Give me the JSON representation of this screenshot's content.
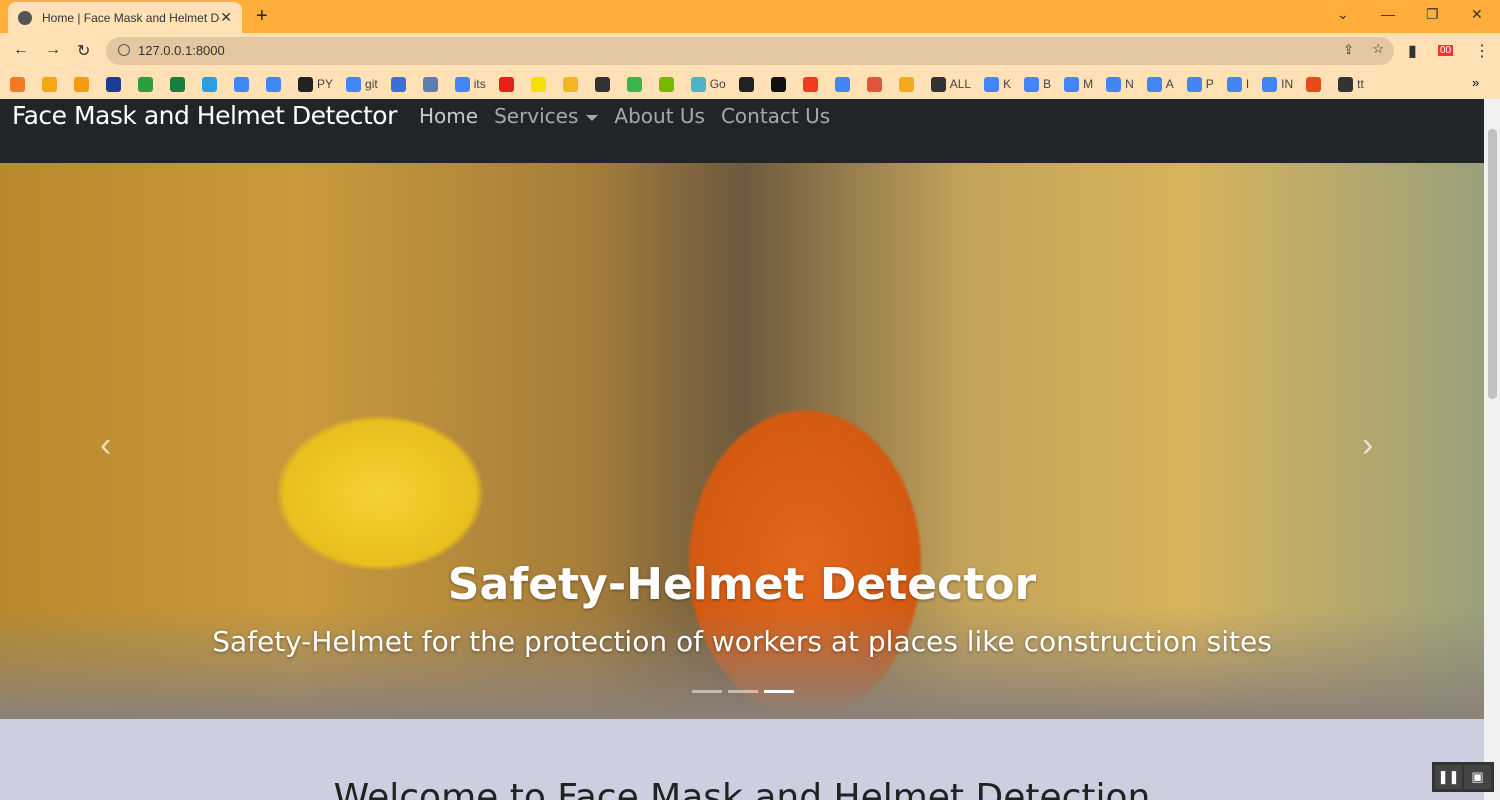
{
  "browser": {
    "tab_title": "Home | Face Mask and Helmet Detector",
    "url": "127.0.0.1:8000",
    "bookmarks": [
      {
        "label": "",
        "color": "#f07b22"
      },
      {
        "label": "",
        "color": "#f3a712"
      },
      {
        "label": "",
        "color": "#f39c12"
      },
      {
        "label": "",
        "color": "#1f3a93"
      },
      {
        "label": "",
        "color": "#2e9e3b"
      },
      {
        "label": "",
        "color": "#1a7f3e"
      },
      {
        "label": "",
        "color": "#2a9fe0"
      },
      {
        "label": "",
        "color": "#4285f4"
      },
      {
        "label": "",
        "color": "#4285f4"
      },
      {
        "label": "PY",
        "color": "#222"
      },
      {
        "label": "git",
        "color": "#4285f4"
      },
      {
        "label": "",
        "color": "#3a6fd8"
      },
      {
        "label": "",
        "color": "#5b7fb5"
      },
      {
        "label": "its",
        "color": "#4285f4"
      },
      {
        "label": "",
        "color": "#e62117"
      },
      {
        "label": "",
        "color": "#f5e000"
      },
      {
        "label": "",
        "color": "#f3b61f"
      },
      {
        "label": "",
        "color": "#333"
      },
      {
        "label": "",
        "color": "#3bb54a"
      },
      {
        "label": "",
        "color": "#76b900"
      },
      {
        "label": "Go",
        "color": "#4ab3c5"
      },
      {
        "label": "",
        "color": "#222"
      },
      {
        "label": "",
        "color": "#111"
      },
      {
        "label": "",
        "color": "#f03c1d"
      },
      {
        "label": "",
        "color": "#4285f4"
      },
      {
        "label": "",
        "color": "#e5533d"
      },
      {
        "label": "",
        "color": "#f7a81b"
      },
      {
        "label": "ALL",
        "color": "#333"
      },
      {
        "label": "K",
        "color": "#4285f4"
      },
      {
        "label": "B",
        "color": "#4285f4"
      },
      {
        "label": "M",
        "color": "#4285f4"
      },
      {
        "label": "N",
        "color": "#4285f4"
      },
      {
        "label": "A",
        "color": "#4285f4"
      },
      {
        "label": "P",
        "color": "#4285f4"
      },
      {
        "label": "I",
        "color": "#4285f4"
      },
      {
        "label": "IN",
        "color": "#4285f4"
      },
      {
        "label": "",
        "color": "#e64a19"
      },
      {
        "label": "tt",
        "color": "#333"
      }
    ],
    "overflow": "»"
  },
  "navbar": {
    "brand": "Face Mask and Helmet Detector",
    "links": [
      "Home",
      "Services",
      "About Us",
      "Contact Us"
    ]
  },
  "carousel": {
    "title": "Safety-Helmet Detector",
    "subtitle": "Safety-Helmet for the protection of workers at places like construction sites",
    "prev": "‹",
    "next": "›",
    "slides": 3,
    "active_slide": 3
  },
  "welcome": {
    "heading": "Welcome to Face Mask and Helmet Detection"
  },
  "pip": {
    "pause": "❚❚",
    "expand": "▣"
  }
}
